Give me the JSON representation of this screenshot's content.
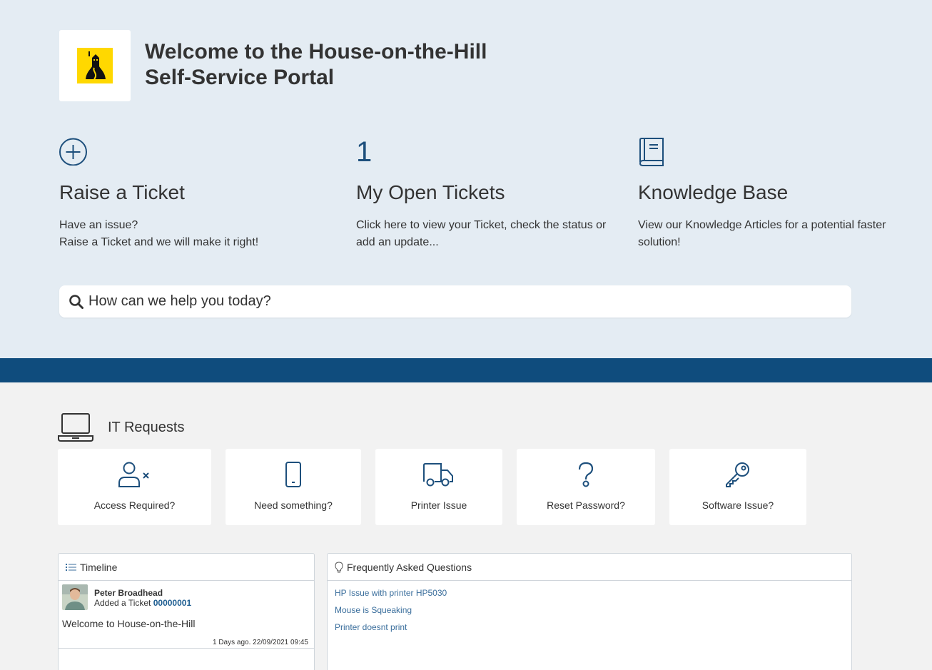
{
  "header": {
    "title_line1": "Welcome to the House-on-the-Hill",
    "title_line2": "Self-Service Portal",
    "logo_icon": "house-on-hill-logo",
    "logo_color": "#ffd800"
  },
  "tiles": [
    {
      "icon": "plus-circle-icon",
      "heading": "Raise a Ticket",
      "line1": "Have an issue?",
      "line2": "Raise a Ticket and we will make it right!"
    },
    {
      "count": "1",
      "heading": "My Open Tickets",
      "line1": "Click here to view your Ticket, check the status or",
      "line2": "add an update..."
    },
    {
      "icon": "book-icon",
      "heading": "Knowledge Base",
      "line1": "View our Knowledge Articles for a potential faster",
      "line2": "solution!"
    }
  ],
  "search": {
    "placeholder": "How can we help you today?"
  },
  "band_color": "#0f4c7d",
  "it_requests": {
    "title": "IT Requests",
    "icon": "laptop-icon",
    "items": [
      {
        "label": "Access Required?",
        "icon": "user-x-icon"
      },
      {
        "label": "Need something?",
        "icon": "mobile-icon"
      },
      {
        "label": "Printer Issue",
        "icon": "truck-icon"
      },
      {
        "label": "Reset Password?",
        "icon": "question-icon"
      },
      {
        "label": "Software Issue?",
        "icon": "key-icon"
      }
    ]
  },
  "timeline": {
    "title": "Timeline",
    "entry": {
      "name": "Peter Broadhead",
      "action": "Added a Ticket",
      "ticket": "00000001",
      "message": "Welcome to House-on-the-Hill",
      "time": "1 Days ago. 22/09/2021 09:45"
    }
  },
  "faq": {
    "title": "Frequently Asked Questions",
    "items": [
      "HP Issue with printer HP5030",
      "Mouse is Squeaking",
      "Printer doesnt print"
    ]
  },
  "accent_color": "#1d4f7c"
}
